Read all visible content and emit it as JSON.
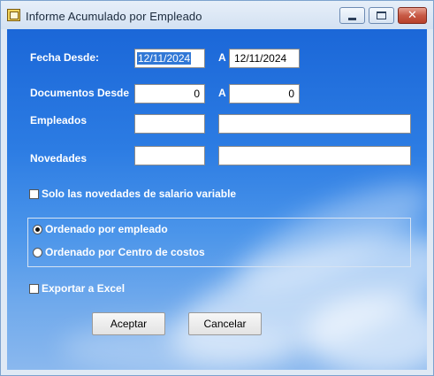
{
  "window": {
    "title": "Informe Acumulado por Empleado",
    "controls": {
      "minimize": "minimize",
      "maximize": "maximize",
      "close": "✕"
    }
  },
  "form": {
    "fecha_desde": {
      "label": "Fecha Desde:",
      "from": "12/11/2024",
      "to_label": "A",
      "to": "12/11/2024"
    },
    "documentos_desde": {
      "label": "Documentos Desde",
      "from": "0",
      "to_label": "A",
      "to": "0"
    },
    "empleados": {
      "label": "Empleados",
      "code": "",
      "name": ""
    },
    "novedades": {
      "label": "Novedades",
      "code": "",
      "name": ""
    },
    "solo_salario_variable": {
      "label": "Solo las novedades de salario variable",
      "checked": false
    },
    "orden": {
      "options": [
        {
          "label": "Ordenado por empleado",
          "selected": true
        },
        {
          "label": "Ordenado por Centro de costos",
          "selected": false
        }
      ]
    },
    "exportar_excel": {
      "label": "Exportar a Excel",
      "checked": false
    }
  },
  "buttons": {
    "accept": "Aceptar",
    "cancel": "Cancelar"
  }
}
